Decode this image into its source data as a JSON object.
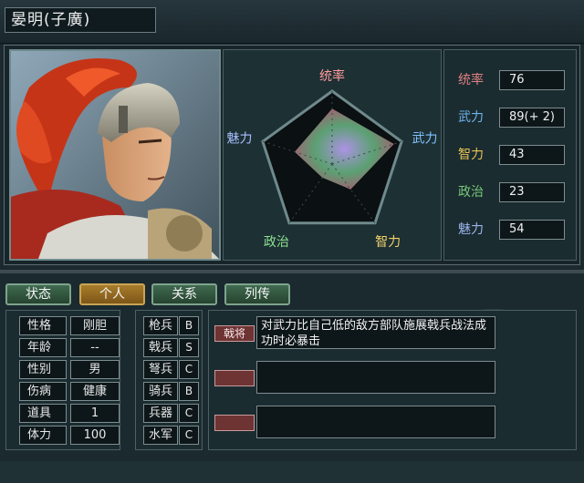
{
  "header": {
    "name": "晏明(子廣)"
  },
  "radar": {
    "labels": {
      "tongshuai": "统率",
      "wuli": "武力",
      "zhili": "智力",
      "zhengzhi": "政治",
      "meili": "魅力"
    },
    "values": {
      "tongshuai": 76,
      "wuli": 89,
      "zhili": 43,
      "zhengzhi": 23,
      "meili": 54
    }
  },
  "stats": [
    {
      "label": "统率",
      "value": "76",
      "color": "#e08080"
    },
    {
      "label": "武力",
      "value": "89(+ 2)",
      "color": "#6fb2e8"
    },
    {
      "label": "智力",
      "value": "43",
      "color": "#e6c254"
    },
    {
      "label": "政治",
      "value": "23",
      "color": "#78c878"
    },
    {
      "label": "魅力",
      "value": "54",
      "color": "#9db4ec"
    }
  ],
  "tabs": [
    {
      "label": "状态",
      "active": false
    },
    {
      "label": "个人",
      "active": true
    },
    {
      "label": "关系",
      "active": false
    },
    {
      "label": "列传",
      "active": false
    }
  ],
  "info": [
    {
      "label": "性格",
      "value": "刚胆"
    },
    {
      "label": "年龄",
      "value": "--"
    },
    {
      "label": "性别",
      "value": "男"
    },
    {
      "label": "伤病",
      "value": "健康"
    },
    {
      "label": "道具",
      "value": "1"
    },
    {
      "label": "体力",
      "value": "100"
    }
  ],
  "troops": [
    {
      "label": "枪兵",
      "grade": "B"
    },
    {
      "label": "戟兵",
      "grade": "S"
    },
    {
      "label": "弩兵",
      "grade": "C"
    },
    {
      "label": "骑兵",
      "grade": "B"
    },
    {
      "label": "兵器",
      "grade": "C"
    },
    {
      "label": "水军",
      "grade": "C"
    }
  ],
  "skills": [
    {
      "tag": "戟将",
      "desc": "对武力比自己低的敌方部队施展戟兵战法成功时必暴击"
    },
    {
      "tag": "",
      "desc": ""
    },
    {
      "tag": "",
      "desc": ""
    }
  ]
}
